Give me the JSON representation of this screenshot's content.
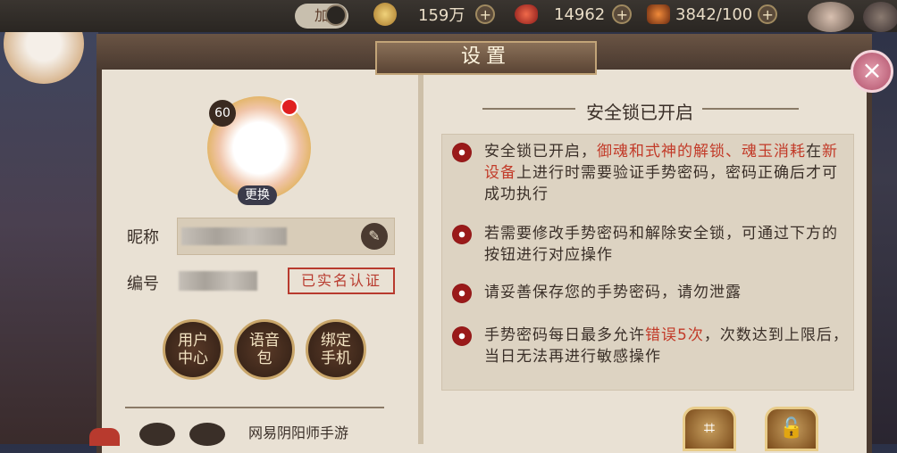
{
  "topbar": {
    "coins": "159万",
    "fish": "14962",
    "stamina": "3842/100",
    "plus": "+",
    "add_btn_label": "加"
  },
  "left": {
    "avatar_level": "60"
  },
  "dialog": {
    "title": "设置",
    "close_label": "×",
    "profile": {
      "level": "60",
      "change_label": "更换",
      "nickname_label": "昵称",
      "id_label": "编号",
      "verified_label": "已实名认证",
      "edit_icon": "pencil-icon"
    },
    "buttons": [
      {
        "label": "用户中心"
      },
      {
        "label": "语音包"
      },
      {
        "label": "绑定手机"
      }
    ],
    "footer_text": "网易阴阳师手游",
    "security": {
      "title": "安全锁已开启",
      "items": [
        {
          "a": "安全锁已开启，",
          "b": "御魂和式神的解锁、魂玉消耗",
          "c": "在",
          "d": "新设备",
          "e": "上进行时需要验证手势密码，密码正确后才可成功执行"
        },
        {
          "text": "若需要修改手势密码和解除安全锁，可通过下方的按钮进行对应操作"
        },
        {
          "text": "请妥善保存您的手势密码，请勿泄露"
        },
        {
          "a": "手势密码每日最多允许",
          "b": "错误5次",
          "c": "，次数达到上限后，当日无法再进行敏感操作"
        }
      ]
    }
  },
  "colors": {
    "accent_red": "#c23a28",
    "panel_bg": "#e9e1d4",
    "frame": "#4a3a30"
  }
}
